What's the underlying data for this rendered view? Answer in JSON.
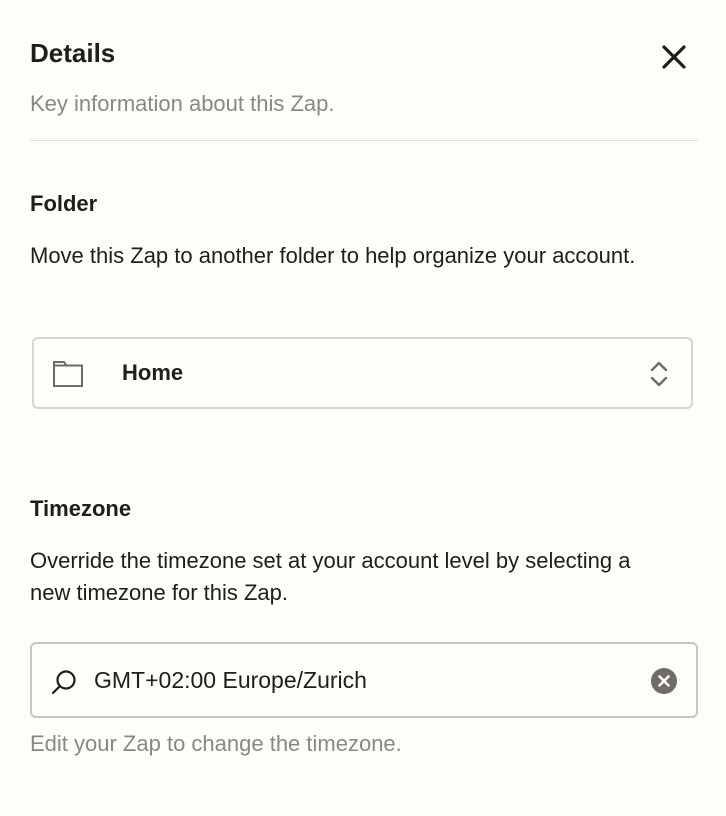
{
  "header": {
    "title": "Details",
    "subtitle": "Key information about this Zap.",
    "close_icon": "close-icon"
  },
  "folder": {
    "heading": "Folder",
    "description": "Move this Zap to another folder to help organize your account.",
    "selected_value": "Home",
    "icons": [
      "folder-icon",
      "chevron-up-down-icon"
    ]
  },
  "timezone": {
    "heading": "Timezone",
    "description": "Override the timezone set at your account level by selecting a new timezone for this Zap.",
    "value": "GMT+02:00 Europe/Zurich",
    "help_text": "Edit your Zap to change the timezone.",
    "icons": [
      "search-icon",
      "clear-icon"
    ]
  },
  "colors": {
    "background": "#fdfdfa",
    "text": "#201d1a",
    "muted_text": "#8b8782",
    "border": "#d8d5cf",
    "clear_button": "#6f6b66"
  }
}
